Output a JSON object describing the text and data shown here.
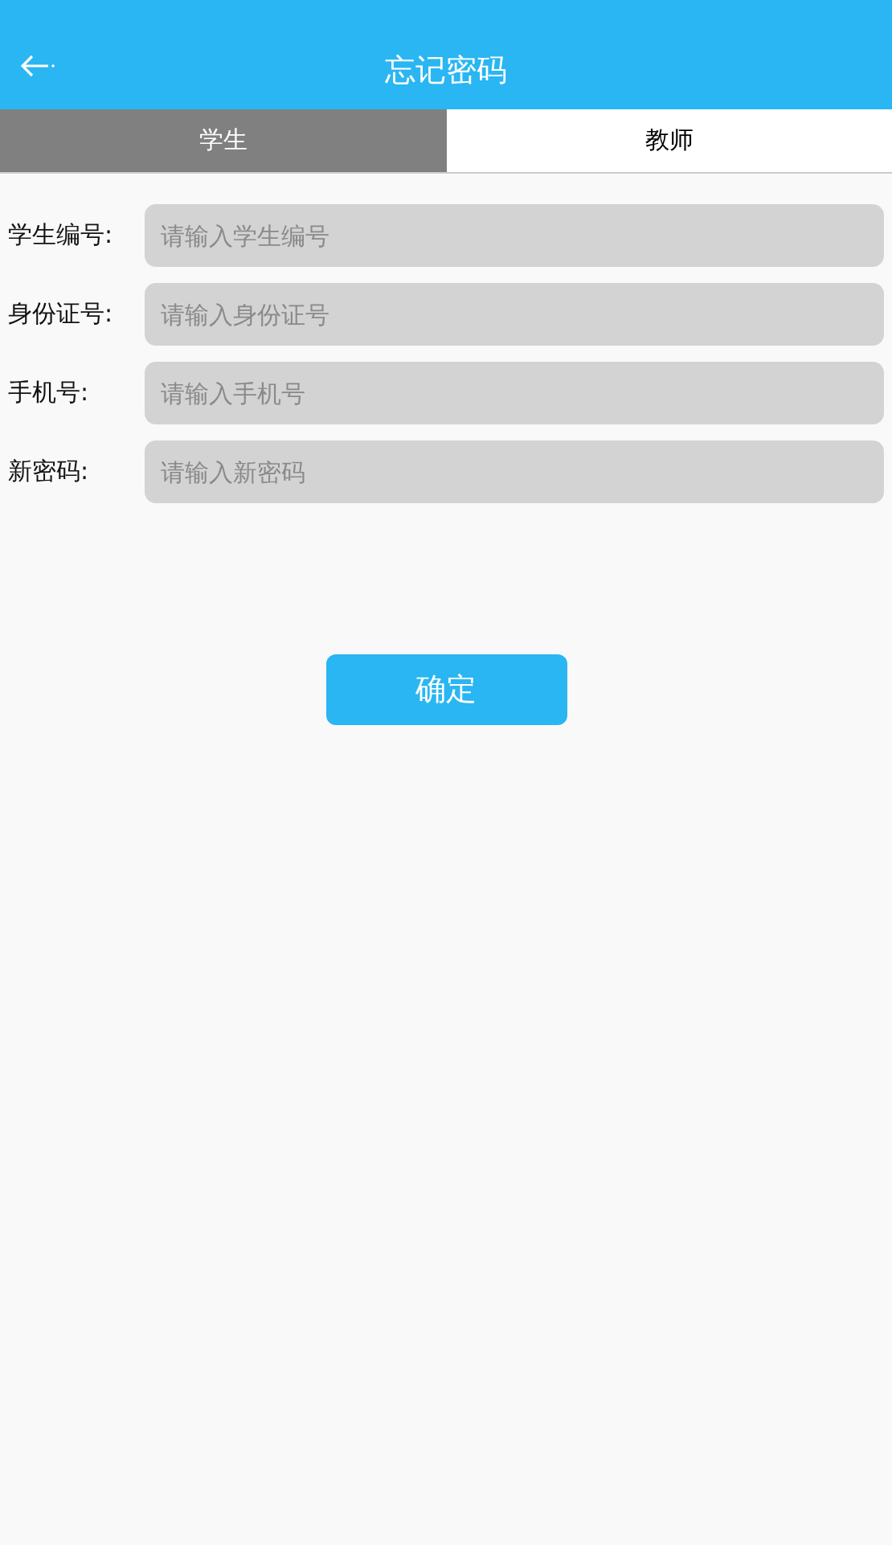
{
  "header": {
    "title": "忘记密码"
  },
  "tabs": [
    {
      "label": "学生",
      "selected": true
    },
    {
      "label": "教师",
      "selected": false
    }
  ],
  "fields": [
    {
      "label": "学生编号:",
      "placeholder": "请输入学生编号"
    },
    {
      "label": "身份证号:",
      "placeholder": "请输入身份证号"
    },
    {
      "label": "手机号:",
      "placeholder": "请输入手机号"
    },
    {
      "label": "新密码:",
      "placeholder": "请输入新密码"
    }
  ],
  "submit_button": "确定"
}
